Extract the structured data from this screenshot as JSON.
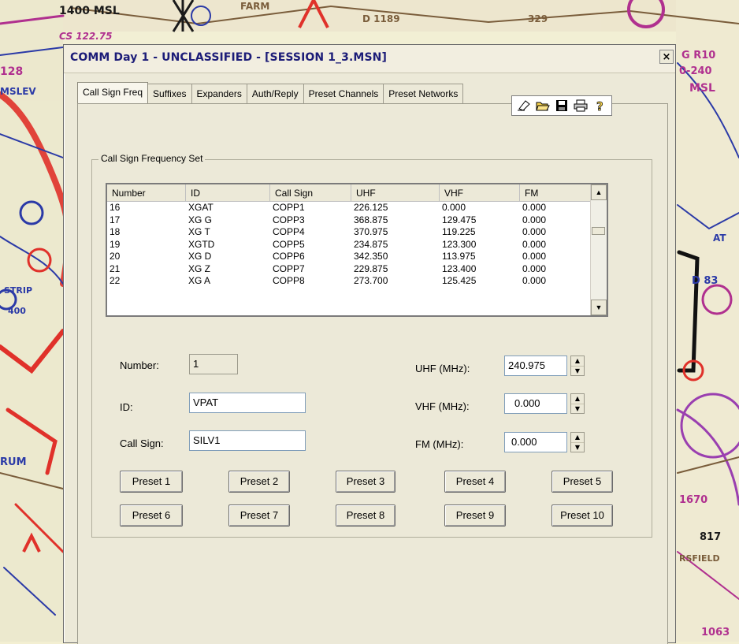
{
  "window": {
    "title": "COMM Day 1 - UNCLASSIFIED - [SESSION 1_3.MSN]",
    "close_label": "×"
  },
  "tabs": [
    {
      "label": "Call Sign Freq",
      "active": true
    },
    {
      "label": "Suffixes"
    },
    {
      "label": "Expanders"
    },
    {
      "label": "Auth/Reply"
    },
    {
      "label": "Preset Channels"
    },
    {
      "label": "Preset Networks"
    }
  ],
  "toolbar": {
    "icons": [
      "eraser-icon",
      "open-folder-icon",
      "save-icon",
      "print-icon",
      "help-icon"
    ]
  },
  "group": {
    "title": "Call Sign Frequency Set"
  },
  "list": {
    "columns": [
      "Number",
      "ID",
      "Call Sign",
      "UHF",
      "VHF",
      "FM"
    ],
    "rows": [
      [
        "16",
        "XGAT",
        "COPP1",
        "226.125",
        "0.000",
        "0.000"
      ],
      [
        "17",
        "XG G",
        "COPP3",
        "368.875",
        "129.475",
        "0.000"
      ],
      [
        "18",
        "XG T",
        "COPP4",
        "370.975",
        "119.225",
        "0.000"
      ],
      [
        "19",
        "XGTD",
        "COPP5",
        "234.875",
        "123.300",
        "0.000"
      ],
      [
        "20",
        "XG D",
        "COPP6",
        "342.350",
        "113.975",
        "0.000"
      ],
      [
        "21",
        "XG Z",
        "COPP7",
        "229.875",
        "123.400",
        "0.000"
      ],
      [
        "22",
        "XG A",
        "COPP8",
        "273.700",
        "125.425",
        "0.000"
      ]
    ]
  },
  "form": {
    "number_label": "Number:",
    "number_value": "1",
    "id_label": "ID:",
    "id_value": "VPAT",
    "callsign_label": "Call Sign:",
    "callsign_value": "SILV1",
    "uhf_label": "UHF (MHz):",
    "uhf_value": "240.975",
    "vhf_label": "VHF (MHz):",
    "vhf_value": "0.000",
    "fm_label": "FM (MHz):",
    "fm_value": "0.000"
  },
  "presets": [
    "Preset 1",
    "Preset 2",
    "Preset 3",
    "Preset 4",
    "Preset 5",
    "Preset 6",
    "Preset 7",
    "Preset 8",
    "Preset 9",
    "Preset 10"
  ],
  "map": {
    "labels": [
      "1400 MSL",
      "CS 122.75",
      "FARM",
      "D 1189",
      "329",
      "128",
      "MSLEV",
      "STRIP",
      "400",
      "RUM",
      "1670",
      "817",
      "RSFIELD",
      "1063",
      "AT",
      "D 83",
      "G R10",
      "0-240",
      "MSL"
    ]
  },
  "colors": {
    "title_text": "#1c1c78",
    "dialog_bg": "#ece9d8"
  }
}
